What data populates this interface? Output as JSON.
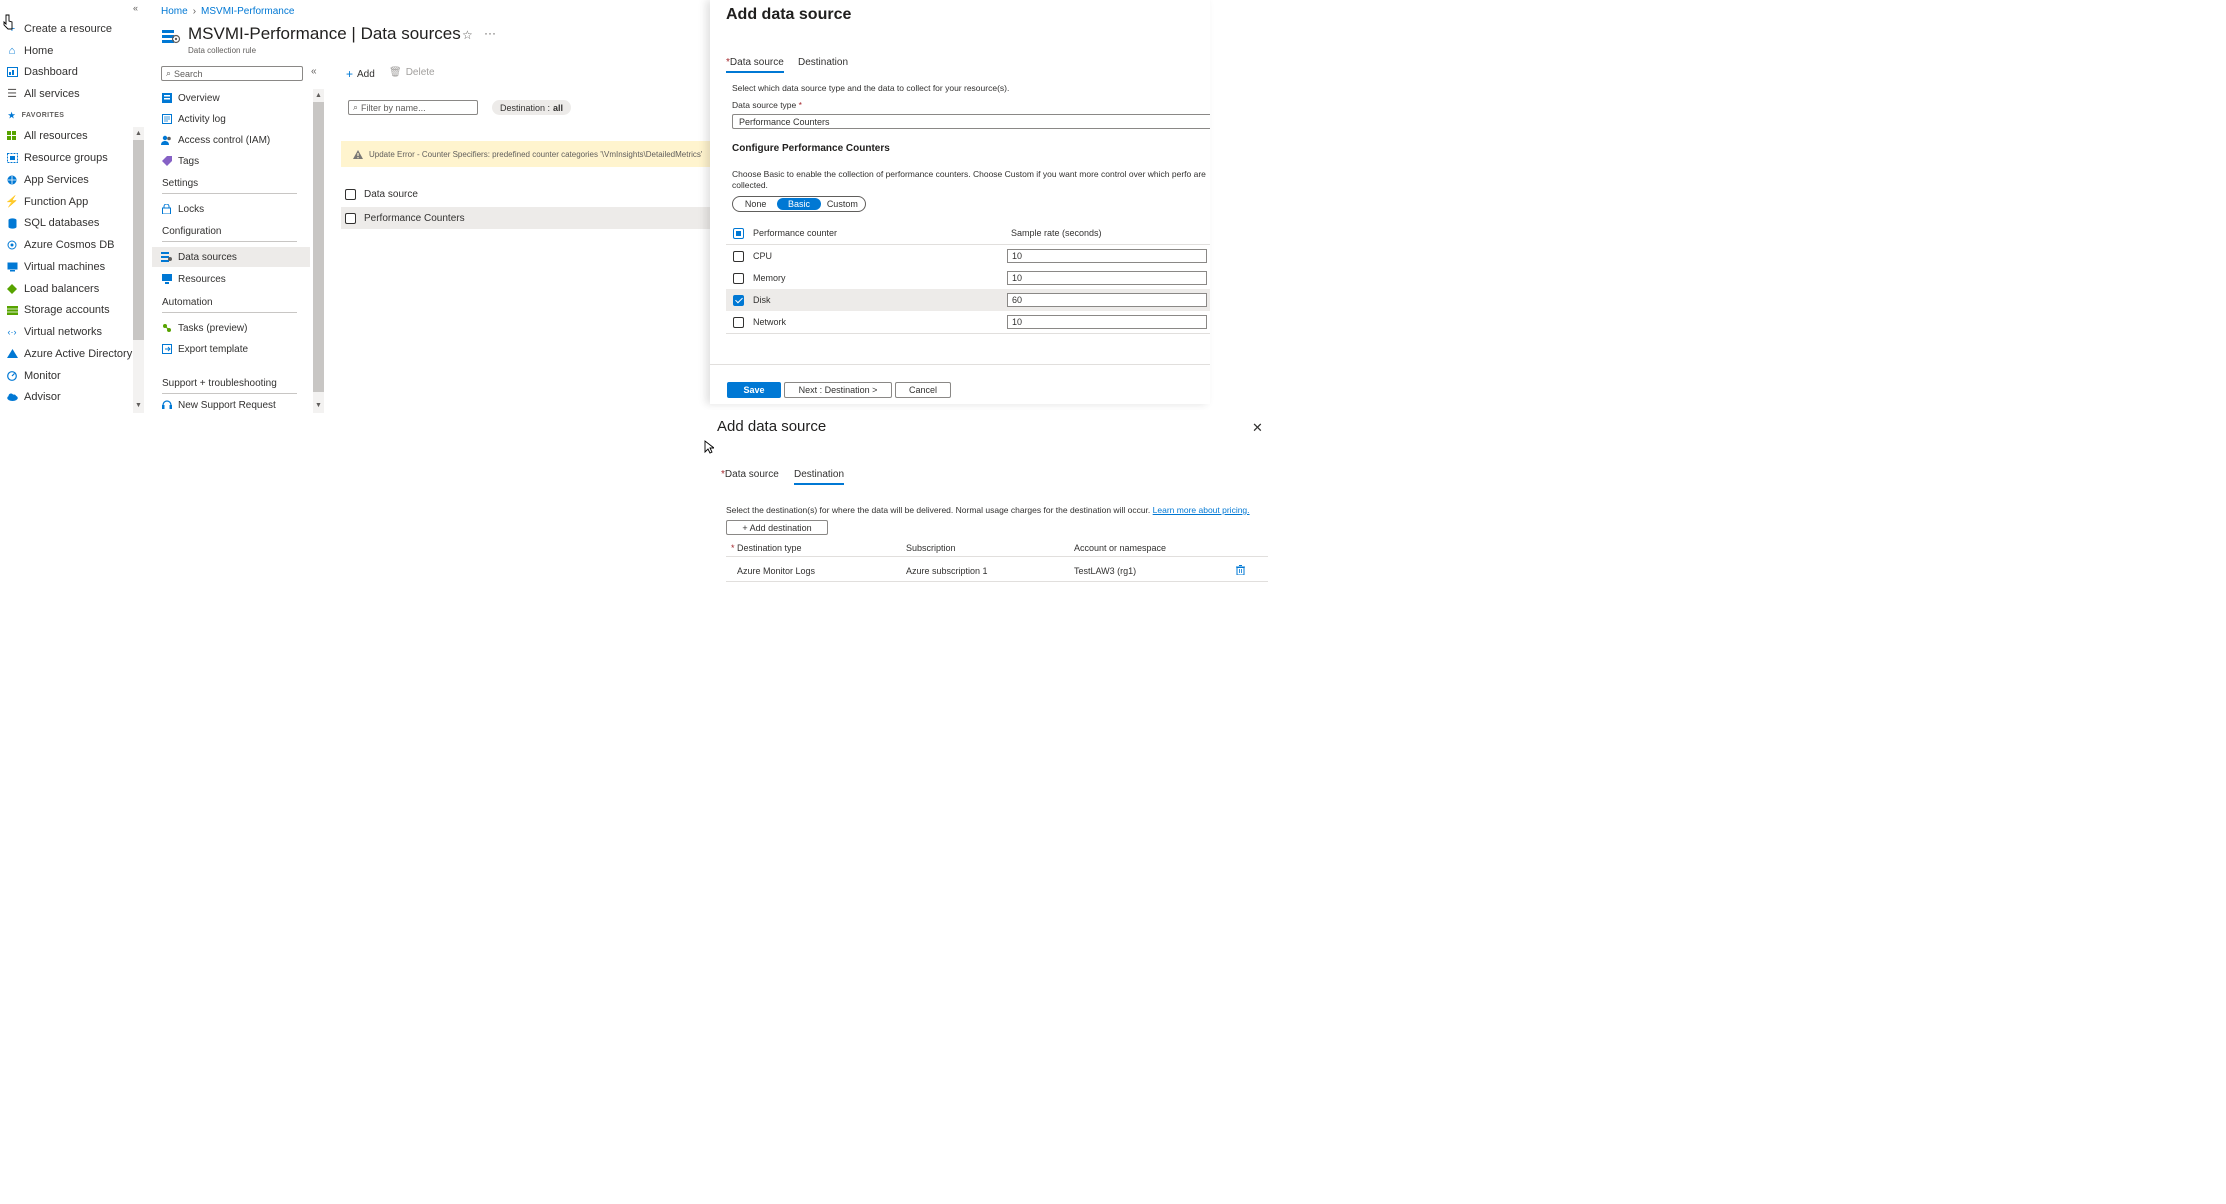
{
  "global_nav": {
    "items": [
      {
        "label": "Create a resource",
        "icon": "plus-icon"
      },
      {
        "label": "Home",
        "icon": "home-icon"
      },
      {
        "label": "Dashboard",
        "icon": "dashboard-icon"
      },
      {
        "label": "All services",
        "icon": "list-icon"
      },
      {
        "label": "All resources",
        "icon": "grid-icon"
      },
      {
        "label": "Resource groups",
        "icon": "resource-group-icon"
      },
      {
        "label": "App Services",
        "icon": "globe-icon"
      },
      {
        "label": "Function App",
        "icon": "lightning-icon"
      },
      {
        "label": "SQL databases",
        "icon": "database-icon"
      },
      {
        "label": "Azure Cosmos DB",
        "icon": "cosmos-icon"
      },
      {
        "label": "Virtual machines",
        "icon": "monitor-icon"
      },
      {
        "label": "Load balancers",
        "icon": "diamond-icon"
      },
      {
        "label": "Storage accounts",
        "icon": "storage-icon"
      },
      {
        "label": "Virtual networks",
        "icon": "network-icon"
      },
      {
        "label": "Azure Active Directory",
        "icon": "aad-icon"
      },
      {
        "label": "Monitor",
        "icon": "gauge-icon"
      },
      {
        "label": "Advisor",
        "icon": "cloud-icon"
      }
    ],
    "favorites_label": "FAVORITES"
  },
  "header": {
    "breadcrumb": [
      "Home",
      "MSVMI-Performance"
    ],
    "title": "MSVMI-Performance | Data sources",
    "subtitle": "Data collection rule"
  },
  "resource_menu": {
    "search_placeholder": "Search",
    "top_items": [
      "Overview",
      "Activity log",
      "Access control (IAM)",
      "Tags"
    ],
    "sections": [
      {
        "title": "Settings",
        "items": [
          "Locks"
        ]
      },
      {
        "title": "Configuration",
        "items": [
          "Data sources",
          "Resources"
        ]
      },
      {
        "title": "Automation",
        "items": [
          "Tasks (preview)",
          "Export template"
        ]
      },
      {
        "title": "Support + troubleshooting",
        "items": [
          "New Support Request"
        ]
      }
    ]
  },
  "content": {
    "toolbar": {
      "add": "Add",
      "delete": "Delete"
    },
    "filter_placeholder": "Filter by name...",
    "destination_pill": {
      "label": "Destination :",
      "value": "all"
    },
    "warning": "Update Error - Counter Specifiers: predefined counter categories '\\VmInsights\\DetailedMetrics'",
    "list_header": "Data source",
    "rows": [
      "Performance Counters"
    ]
  },
  "panel_data_source": {
    "title": "Add data source",
    "tabs": [
      "Data source",
      "Destination"
    ],
    "intro": "Select which data source type and the data to collect for your resource(s).",
    "type_label": "Data source type",
    "type_value": "Performance Counters",
    "config_heading": "Configure Performance Counters",
    "config_desc": "Choose Basic to enable the collection of performance counters. Choose Custom if you want more control over which perfo are collected.",
    "modes": [
      "None",
      "Basic",
      "Custom"
    ],
    "selected_mode": "Basic",
    "table_headers": {
      "counter": "Performance counter",
      "rate": "Sample rate (seconds)"
    },
    "counters": [
      {
        "name": "CPU",
        "rate": "10",
        "checked": false
      },
      {
        "name": "Memory",
        "rate": "10",
        "checked": false
      },
      {
        "name": "Disk",
        "rate": "60",
        "checked": true
      },
      {
        "name": "Network",
        "rate": "10",
        "checked": false
      }
    ],
    "buttons": {
      "save": "Save",
      "next": "Next : Destination >",
      "cancel": "Cancel"
    }
  },
  "panel_destination": {
    "title": "Add data source",
    "tabs": [
      "Data source",
      "Destination"
    ],
    "description": "Select the destination(s) for where the data will be delivered. Normal usage charges for the destination will occur.",
    "link": "Learn more about pricing.",
    "add_button": "+ Add destination",
    "columns": [
      "Destination type",
      "Subscription",
      "Account or namespace"
    ],
    "rows": [
      {
        "type": "Azure Monitor Logs",
        "subscription": "Azure subscription 1",
        "account": "TestLAW3 (rg1)"
      }
    ]
  },
  "colors": {
    "accent": "#0078d4",
    "warning_bg": "#fff4ce",
    "selected_bg": "#edebe9"
  }
}
